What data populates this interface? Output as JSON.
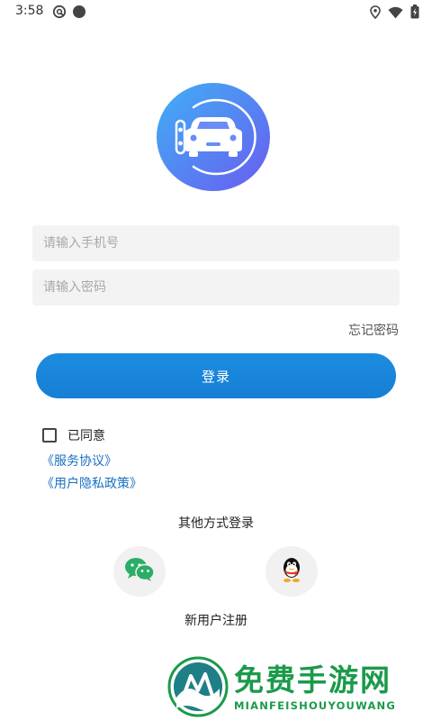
{
  "status_bar": {
    "time": "3:58",
    "left_icons": [
      "vpn-key-icon",
      "record-dot-icon"
    ],
    "right_icons": [
      "location-icon",
      "wifi-icon",
      "battery-icon"
    ]
  },
  "form": {
    "phone_placeholder": "请输入手机号",
    "phone_value": "",
    "password_placeholder": "请输入密码",
    "password_value": "",
    "forgot_password": "忘记密码",
    "login_button": "登录"
  },
  "agreement": {
    "checked": false,
    "label": "已同意",
    "service_link": "《服务协议》",
    "privacy_link": "《用户隐私政策》"
  },
  "other_login": {
    "title": "其他方式登录",
    "methods": [
      "wechat-icon",
      "qq-icon"
    ]
  },
  "register_link": "新用户注册",
  "watermark": {
    "title": "免费手游网",
    "subtitle": "MIANFEISHOUYOUWANG"
  },
  "colors": {
    "accent": "#157fd4",
    "link": "#1a6fc0",
    "input_bg": "#f3f3f3",
    "logo_gradient_start": "#3fb0f5",
    "logo_gradient_end": "#6a5cf0",
    "watermark_green": "#1a9a4a"
  }
}
